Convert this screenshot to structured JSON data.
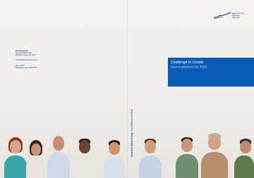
{
  "back_cover": {
    "imprint_heading": "Herausgeber",
    "imprint_lines": [
      "Deutsche Börse AG",
      "60485 Frankfurt am Main"
    ],
    "imprint_web": "www.deutsche-boerse.com",
    "imprint_extra": [
      "März 2007",
      "Bestellnummer 1000-2456"
    ]
  },
  "spine": {
    "brand": "Deutsche Börse Group",
    "title": "Geschäftsbericht 2006"
  },
  "front_cover": {
    "logo_lines": [
      "DEUTSCHE BÖRSE",
      "GROUP"
    ],
    "title": "Challenge to Create",
    "subtitle": "Geschäftsbericht 2006"
  },
  "colors": {
    "accent_blue": "#0a5bb5",
    "text_blue": "#1b3f8f",
    "subtitle_blue": "#9fc7ef"
  },
  "icons": {
    "logo_mark": "wave-logo-icon",
    "photo_strip": "people-photo"
  }
}
